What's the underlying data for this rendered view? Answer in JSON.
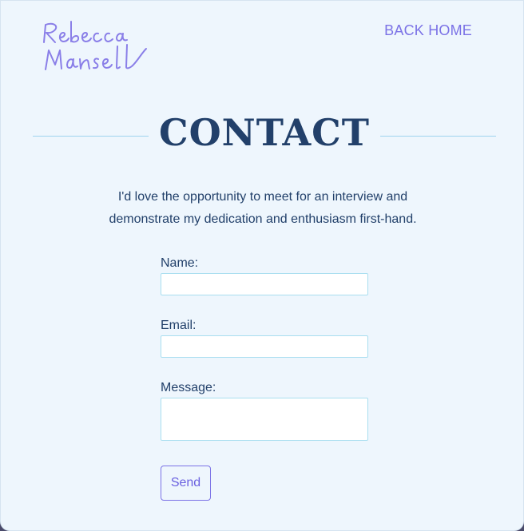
{
  "header": {
    "logo_text": "Rebecca Mansell",
    "back_home_label": "BACK HOME"
  },
  "main": {
    "title": "CONTACT",
    "intro_line1": "I'd love the opportunity to meet for an interview and",
    "intro_line2": "demonstrate my dedication and enthusiasm first-hand."
  },
  "form": {
    "name_label": "Name:",
    "name_value": "",
    "email_label": "Email:",
    "email_value": "",
    "message_label": "Message:",
    "message_value": "",
    "send_label": "Send"
  },
  "colors": {
    "background": "#eef6fd",
    "heading": "#22406a",
    "accent": "#7b72e6",
    "field_border": "#a9def0"
  }
}
